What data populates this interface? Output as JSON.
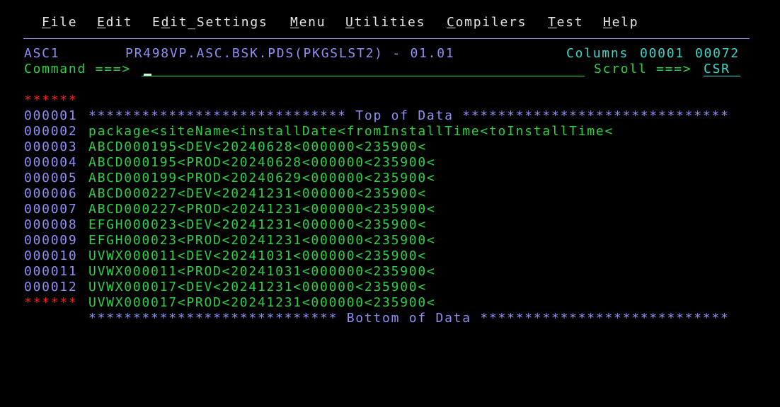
{
  "menu_bar": {
    "items": [
      {
        "pre": "",
        "hot": "F",
        "post": "ile"
      },
      {
        "pre": "",
        "hot": "E",
        "post": "dit"
      },
      {
        "pre": "E",
        "hot": "d",
        "post": "it_Settings"
      },
      {
        "pre": "",
        "hot": "M",
        "post": "enu"
      },
      {
        "pre": "",
        "hot": "U",
        "post": "tilities"
      },
      {
        "pre": "",
        "hot": "C",
        "post": "ompilers"
      },
      {
        "pre": "",
        "hot": "T",
        "post": "est"
      },
      {
        "pre": "",
        "hot": "H",
        "post": "elp"
      }
    ]
  },
  "header": {
    "mode": "ASC1",
    "dataset": "PR498VP.ASC.BSK.PDS(PKGSLST2) - 01.01",
    "columns_label": "Columns",
    "col_start": "00001",
    "col_end": "00072"
  },
  "command": {
    "label": "Command ===>",
    "value": "",
    "scroll_label": "Scroll ===>",
    "scroll_value": "CSR"
  },
  "top_marker": {
    "prefix": "******",
    "text": "***************************** Top of Data ******************************"
  },
  "lines": [
    {
      "num": "000001",
      "text": "package<siteName<installDate<fromInstallTime<toInstallTime<"
    },
    {
      "num": "000002",
      "text": "ABCD000195<DEV<20240628<000000<235900<"
    },
    {
      "num": "000003",
      "text": "ABCD000195<PROD<20240628<000000<235900<"
    },
    {
      "num": "000004",
      "text": "ABCD000199<PROD<20240629<000000<235900<"
    },
    {
      "num": "000005",
      "text": "ABCD000227<DEV<20241231<000000<235900<"
    },
    {
      "num": "000006",
      "text": "ABCD000227<PROD<20241231<000000<235900<"
    },
    {
      "num": "000007",
      "text": "EFGH000023<DEV<20241231<000000<235900<"
    },
    {
      "num": "000008",
      "text": "EFGH000023<PROD<20241231<000000<235900<"
    },
    {
      "num": "000009",
      "text": "UVWX000011<DEV<20241031<000000<235900<"
    },
    {
      "num": "000010",
      "text": "UVWX000011<PROD<20241031<000000<235900<"
    },
    {
      "num": "000011",
      "text": "UVWX000017<DEV<20241231<000000<235900<"
    },
    {
      "num": "000012",
      "text": "UVWX000017<PROD<20241231<000000<235900<"
    }
  ],
  "bottom_marker": {
    "prefix": "******",
    "text": "**************************** Bottom of Data ****************************"
  },
  "colors": {
    "background": "#000000",
    "menu_text": "#e6e6e6",
    "blue": "#8d8ff2",
    "green": "#2ed044",
    "turquoise": "#3fd5c8",
    "red": "#ff2020"
  }
}
